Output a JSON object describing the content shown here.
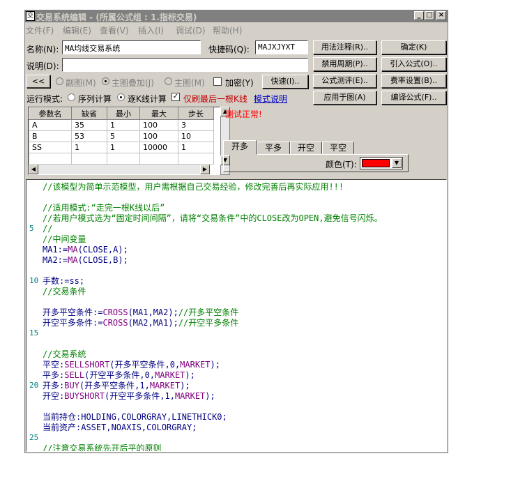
{
  "window": {
    "title": "交易系统编辑 - (所属公式组 : 1.指标交易)",
    "min_glyph": "_",
    "max_glyph": "□",
    "close_glyph": "×"
  },
  "menu": [
    "文件(F)",
    "编辑(E)",
    "查看(V)",
    "插入(I)",
    "调试(D)",
    "帮助(H)"
  ],
  "form": {
    "name_label": "名称(N):",
    "name_value": "MA均线交易系统",
    "shortcut_label": "快捷码(Q):",
    "shortcut_value": "MAJXJYXT",
    "desc_label": "说明(D):",
    "desc_value": ""
  },
  "buttons": {
    "usage_notes": "用法注释(R)..",
    "confirm": "确定(K)",
    "forbid_period": "禁用周期(P)..",
    "import_formula": "引入公式(O)..",
    "formula_test": "公式测评(E)..",
    "fee_settings": "费率设置(B)..",
    "apply_to_chart": "应用于图(A)",
    "compile_formula": "编译公式(F)..",
    "collapse": "<<",
    "quick": "快速(I).."
  },
  "chart_options": {
    "sub_chart": "副图(M)",
    "main_overlay": "主图叠加(J)",
    "main_chart": "主图(M)",
    "encrypt": "加密(Y)"
  },
  "run_mode": {
    "label": "运行模式:",
    "sequential": "序列计算",
    "per_bar": "逐K线计算",
    "last_bar_only": "仅刷最后一根K线",
    "mode_help": "模式说明"
  },
  "test_status": "测试正常!",
  "params": {
    "headers": [
      "参数名",
      "缺省",
      "最小",
      "最大",
      "步长"
    ],
    "rows": [
      [
        "A",
        "35",
        "1",
        "100",
        "3"
      ],
      [
        "B",
        "53",
        "5",
        "100",
        "10"
      ],
      [
        "SS",
        "1",
        "1",
        "10000",
        "1"
      ]
    ]
  },
  "signal_tabs": [
    "开多",
    "平多",
    "开空",
    "平空"
  ],
  "color_label": "颜色(T):",
  "signal_color": "#ff0000",
  "code": {
    "line_numbers": [
      {
        "n": "5",
        "line": 5
      },
      {
        "n": "10",
        "line": 10
      },
      {
        "n": "15",
        "line": 15
      },
      {
        "n": "20",
        "line": 20
      },
      {
        "n": "25",
        "line": 25
      }
    ],
    "lines": [
      [
        {
          "t": "//该模型为简单示范模型，用户需根据自己交易经验，修改完善后再实际应用!!!",
          "c": "c-comment"
        }
      ],
      [],
      [
        {
          "t": "//适用模式:“走完一根K线以后”",
          "c": "c-comment"
        }
      ],
      [
        {
          "t": "//若用户模式选为“固定时间间隔”，请将“交易条件”中的CLOSE改为OPEN,避免信号闪烁。",
          "c": "c-comment"
        }
      ],
      [
        {
          "t": "//",
          "c": "c-comment"
        }
      ],
      [
        {
          "t": "//中间变量",
          "c": "c-comment"
        }
      ],
      [
        {
          "t": "MA1:=",
          "c": "c-text"
        },
        {
          "t": "MA",
          "c": "c-kw"
        },
        {
          "t": "(CLOSE,A);",
          "c": "c-text"
        }
      ],
      [
        {
          "t": "MA2:=",
          "c": "c-text"
        },
        {
          "t": "MA",
          "c": "c-kw"
        },
        {
          "t": "(CLOSE,B);",
          "c": "c-text"
        }
      ],
      [],
      [
        {
          "t": "手数:=ss;",
          "c": "c-text"
        }
      ],
      [
        {
          "t": "//交易条件",
          "c": "c-comment"
        }
      ],
      [],
      [
        {
          "t": "开多平空条件:=",
          "c": "c-text"
        },
        {
          "t": "CROSS",
          "c": "c-kw"
        },
        {
          "t": "(MA1,MA2);",
          "c": "c-text"
        },
        {
          "t": "//开多平空条件",
          "c": "c-comment"
        }
      ],
      [
        {
          "t": "开空平多条件:=",
          "c": "c-text"
        },
        {
          "t": "CROSS",
          "c": "c-kw"
        },
        {
          "t": "(MA2,MA1);",
          "c": "c-text"
        },
        {
          "t": "//开空平多条件",
          "c": "c-comment"
        }
      ],
      [],
      [],
      [
        {
          "t": "//交易系统",
          "c": "c-comment"
        }
      ],
      [
        {
          "t": "平空:",
          "c": "c-text"
        },
        {
          "t": "SELLSHORT",
          "c": "c-kw"
        },
        {
          "t": "(开多平空条件,0,",
          "c": "c-text"
        },
        {
          "t": "MARKET",
          "c": "c-kw"
        },
        {
          "t": ");",
          "c": "c-text"
        }
      ],
      [
        {
          "t": "平多:",
          "c": "c-text"
        },
        {
          "t": "SELL",
          "c": "c-kw"
        },
        {
          "t": "(开空平多条件,0,",
          "c": "c-text"
        },
        {
          "t": "MARKET",
          "c": "c-kw"
        },
        {
          "t": ");",
          "c": "c-text"
        }
      ],
      [
        {
          "t": "开多:",
          "c": "c-text"
        },
        {
          "t": "BUY",
          "c": "c-kw"
        },
        {
          "t": "(开多平空条件,1,",
          "c": "c-text"
        },
        {
          "t": "MARKET",
          "c": "c-kw"
        },
        {
          "t": ");",
          "c": "c-text"
        }
      ],
      [
        {
          "t": "开空:",
          "c": "c-text"
        },
        {
          "t": "BUYSHORT",
          "c": "c-kw"
        },
        {
          "t": "(开空平多条件,1,",
          "c": "c-text"
        },
        {
          "t": "MARKET",
          "c": "c-kw"
        },
        {
          "t": ");",
          "c": "c-text"
        }
      ],
      [],
      [
        {
          "t": "当前持仓:",
          "c": "c-text"
        },
        {
          "t": "HOLDING,COLORGRAY,LINETHICK0;",
          "c": "c-text"
        }
      ],
      [
        {
          "t": "当前资产:",
          "c": "c-text"
        },
        {
          "t": "ASSET,NOAXIS,COLORGRAY;",
          "c": "c-text"
        }
      ],
      [],
      [
        {
          "t": "//注意交易系统先开后平的原则",
          "c": "c-comment"
        }
      ]
    ]
  }
}
